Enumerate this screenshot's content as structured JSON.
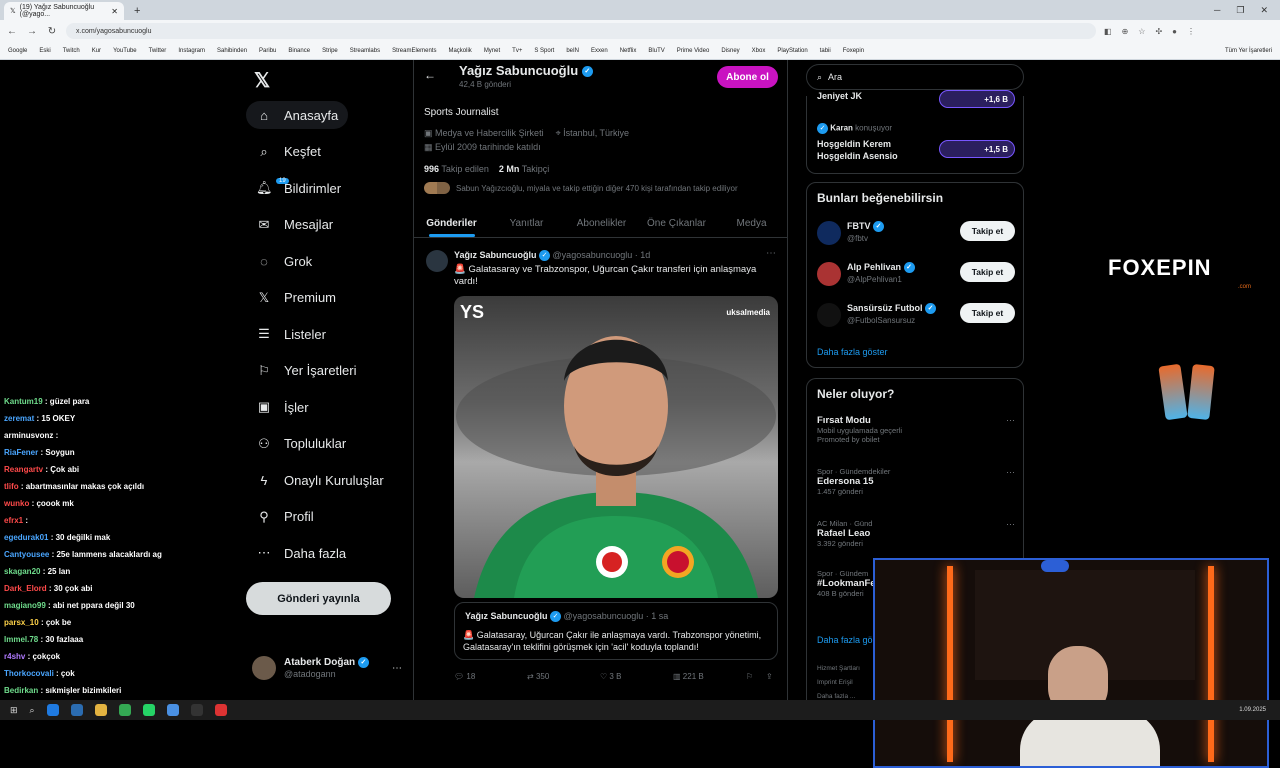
{
  "browser": {
    "tab_title": "(19) Yağız Sabuncuoğlu (@yago...",
    "url": "x.com/yagosabuncuoglu",
    "bookmarks": [
      "Google",
      "Eski",
      "Twitch",
      "Kur",
      "YouTube",
      "Twitter",
      "Instagram",
      "Sahibinden",
      "Paribu",
      "Binance",
      "Stripe",
      "Streamlabs",
      "StreamElements",
      "Maçkolik",
      "Mynet",
      "Tv+",
      "S Sport",
      "beIN",
      "Exxen",
      "Netflix",
      "BluTV",
      "Prime Video",
      "Disney",
      "Xbox",
      "PlayStation",
      "tabii",
      "Foxepin"
    ],
    "all_bookmarks": "Tüm Yer İşaretleri"
  },
  "chat": [
    {
      "user": "Kantum19",
      "text": ": güzel para",
      "color": "#6fdc8c"
    },
    {
      "user": "zeremat",
      "text": ": 15 OKEY",
      "color": "#4aa6ff"
    },
    {
      "user": "arminusvonz",
      "text": ":",
      "color": "#ffffff"
    },
    {
      "user": "RiaFener",
      "text": ": Soygun",
      "color": "#4aa6ff"
    },
    {
      "user": "Reangartv",
      "text": ": Çok abi",
      "color": "#ff4a4a"
    },
    {
      "user": "tlifo",
      "text": ": abartmasınlar makas çok açıldı",
      "color": "#ff4a4a"
    },
    {
      "user": "wunko",
      "text": ": çoook mk",
      "color": "#ff4a4a"
    },
    {
      "user": "efrx1",
      "text": ":",
      "color": "#ff4a4a"
    },
    {
      "user": "egedurak01",
      "text": ": 30 değilki mak",
      "color": "#4aa6ff"
    },
    {
      "user": "Cantyousee",
      "text": ": 25e lammens alacaklardı ag",
      "color": "#4aa6ff"
    },
    {
      "user": "skagan20",
      "text": ": 25 lan",
      "color": "#6fdc8c"
    },
    {
      "user": "Dark_Elord",
      "text": ": 30 çok abi",
      "color": "#ff4a4a"
    },
    {
      "user": "magiano99",
      "text": ": abi net ppara değil 30",
      "color": "#6fdc8c"
    },
    {
      "user": "parsx_10",
      "text": ": çok be",
      "color": "#ffd34a"
    },
    {
      "user": "Immel.78",
      "text": ": 30 fazlaaa",
      "color": "#6fdc8c"
    },
    {
      "user": "r4shv",
      "text": ": çokçok",
      "color": "#b07aff"
    },
    {
      "user": "Thorkocovali",
      "text": ": çok",
      "color": "#4aa6ff"
    },
    {
      "user": "Bedirkan",
      "text": ": sıkmişler bizimkileri",
      "color": "#6fdc8c"
    }
  ],
  "nav": {
    "items": [
      {
        "label": "Anasayfa",
        "icon": "home"
      },
      {
        "label": "Keşfet",
        "icon": "search"
      },
      {
        "label": "Bildirimler",
        "icon": "bell"
      },
      {
        "label": "Mesajlar",
        "icon": "mail"
      },
      {
        "label": "Grok",
        "icon": "grok"
      },
      {
        "label": "Premium",
        "icon": "x"
      },
      {
        "label": "Listeler",
        "icon": "list"
      },
      {
        "label": "Yer İşaretleri",
        "icon": "bookmark"
      },
      {
        "label": "İşler",
        "icon": "briefcase"
      },
      {
        "label": "Topluluklar",
        "icon": "people"
      },
      {
        "label": "Onaylı Kuruluşlar",
        "icon": "bolt"
      },
      {
        "label": "Profil",
        "icon": "person"
      },
      {
        "label": "Daha fazla",
        "icon": "more"
      }
    ],
    "notif_badge": "19",
    "post_button": "Gönderi yayınla",
    "account_name": "Ataberk Doğan",
    "account_handle": "@atadogann"
  },
  "profile": {
    "name": "Yağız Sabuncuoğlu",
    "post_count": "42,4 B gönderi",
    "subscribe": "Abone ol",
    "bio": "Sports Journalist",
    "category": "Medya ve Habercilik Şirketi",
    "location": "İstanbul, Türkiye",
    "joined": "Eylül 2009 tarihinde katıldı",
    "following_count": "996",
    "following_label": "Takip edilen",
    "followers_count": "2 Mn",
    "followers_label": "Takipçi",
    "followed_by": "Sabun Yağızcıoğlu, miyala ve takip ettiğin diğer 470 kişi tarafından takip ediliyor",
    "tabs": [
      "Gönderiler",
      "Yanıtlar",
      "Abonelikler",
      "Öne Çıkanlar",
      "Medya"
    ]
  },
  "tweet": {
    "name": "Yağız Sabuncuoğlu",
    "handle_time": "@yagosabuncuoglu · 1d",
    "text": "🚨 Galatasaray ve Trabzonspor, Uğurcan Çakır transferi için anlaşmaya vardı!",
    "media_logo": "YS",
    "media_watermark": "uksalmedia",
    "quote_name": "Yağız Sabuncuoğlu",
    "quote_handle_time": "@yagosabuncuoglu · 1 sa",
    "quote_text": "🚨 Galatasaray, Uğurcan Çakır ile anlaşmaya vardı. Trabzonspor yönetimi, Galatasaray'ın teklifini görüşmek için 'acil' koduyla toplandı!",
    "replies": "18",
    "reposts": "350",
    "likes": "3 B",
    "views": "221 B"
  },
  "right": {
    "search_placeholder": "Ara",
    "space1_title": "Jeniyet JK",
    "space1_count": "+1,6 B",
    "space2_host": "Karan",
    "space2_status": "konuşuyor",
    "space2_title": "Hoşgeldin Kerem Hoşgeldin Asensio",
    "space2_count": "+1,5 B",
    "suggest_title": "Bunları beğenebilirsin",
    "suggestions": [
      {
        "name": "FBTV",
        "handle": "@fbtv",
        "button": "Takip et",
        "color": "#0f2a5e"
      },
      {
        "name": "Alp Pehlivan",
        "handle": "@AlpPehlivan1",
        "button": "Takip et",
        "color": "#a33"
      },
      {
        "name": "Sansürsüz Futbol",
        "handle": "@FutbolSansursuz",
        "button": "Takip et",
        "color": "#111"
      }
    ],
    "show_more": "Daha fazla göster",
    "news_title": "Neler oluyor?",
    "news": [
      {
        "cat": "",
        "title": "Fırsat Modu",
        "sub": "Mobil uygulamada geçerli",
        "count": "Promoted by obilet"
      },
      {
        "cat": "Spor · Gündemdekiler",
        "title": "Edersona 15",
        "sub": "",
        "count": "1.457 gönderi"
      },
      {
        "cat": "AC Milan · Günd",
        "title": "Rafael Leao",
        "sub": "",
        "count": "3.392 gönderi"
      },
      {
        "cat": "Spor · Gündem",
        "title": "#LookmanFe",
        "sub": "",
        "count": "408 B gönderi"
      }
    ],
    "news_more": "Daha fazla gö",
    "footer1": "Hizmet Şartları",
    "footer2": "Imprint   Erişil",
    "footer3": "Daha fazla ..."
  },
  "overlay": {
    "brand": "FOXEPIN",
    "brand_domain": ".com",
    "can1": "LEMON TEA",
    "can2": "ICE TEA"
  },
  "taskbar": {
    "time": "",
    "date": "1.09.2025"
  }
}
